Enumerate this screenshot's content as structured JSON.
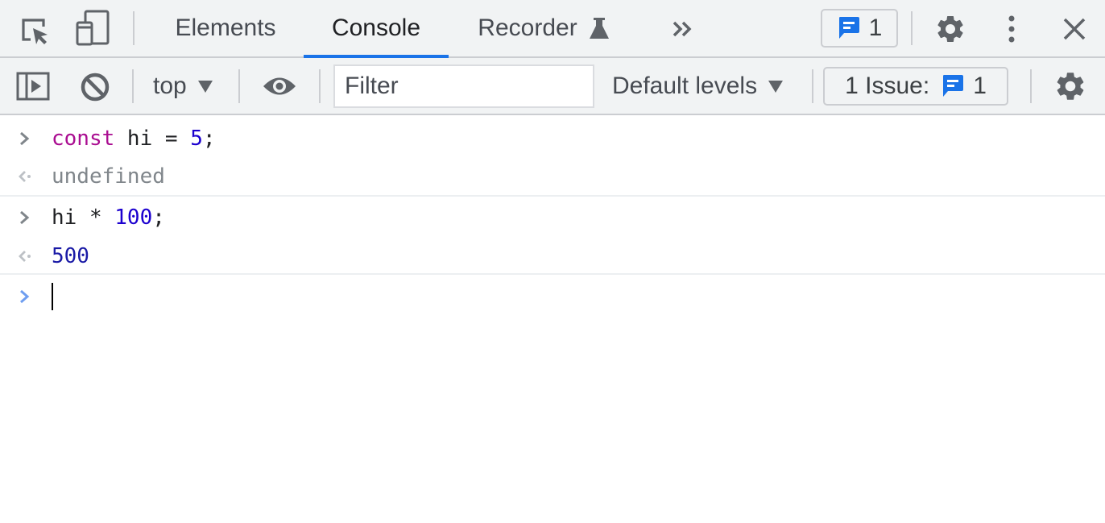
{
  "tabbar": {
    "icons": {
      "inspect": "inspect-element-icon",
      "device": "device-toolbar-icon",
      "more_tabs": "chevron-double-right-icon",
      "settings": "gear-icon",
      "menu": "kebab-menu-icon",
      "close": "close-icon"
    },
    "tabs": [
      {
        "label": "Elements",
        "active": false
      },
      {
        "label": "Console",
        "active": true
      },
      {
        "label": "Recorder",
        "active": false,
        "badge_icon": "flask-icon"
      }
    ],
    "issues_badge": {
      "icon": "message-icon",
      "count": "1"
    }
  },
  "toolbar": {
    "sidebar_icon": "sidebar-toggle-icon",
    "clear_icon": "clear-console-icon",
    "context": "top",
    "live_expression_icon": "eye-icon",
    "filter": {
      "value": "",
      "placeholder": "Filter"
    },
    "levels": "Default levels",
    "issues": {
      "label": "1 Issue:",
      "icon": "message-icon",
      "count": "1"
    },
    "settings_icon": "gear-icon"
  },
  "console": {
    "messages": [
      {
        "type": "input",
        "tokens": [
          {
            "t": "const",
            "c": "kw"
          },
          {
            "t": " hi = ",
            "c": "plain"
          },
          {
            "t": "5",
            "c": "num"
          },
          {
            "t": ";",
            "c": "plain"
          }
        ]
      },
      {
        "type": "output",
        "text": "undefined"
      },
      {
        "type": "input",
        "tokens": [
          {
            "t": "hi * ",
            "c": "plain"
          },
          {
            "t": "100",
            "c": "num"
          },
          {
            "t": ";",
            "c": "plain"
          }
        ]
      },
      {
        "type": "output",
        "text": "500"
      }
    ],
    "prompt_value": ""
  },
  "colors": {
    "accent": "#1a73e8",
    "keyword": "#aa0d91",
    "number": "#1c00cf",
    "result_number": "#1a1aa6",
    "undefined": "#80868b",
    "toolbar_bg": "#f1f3f4"
  }
}
